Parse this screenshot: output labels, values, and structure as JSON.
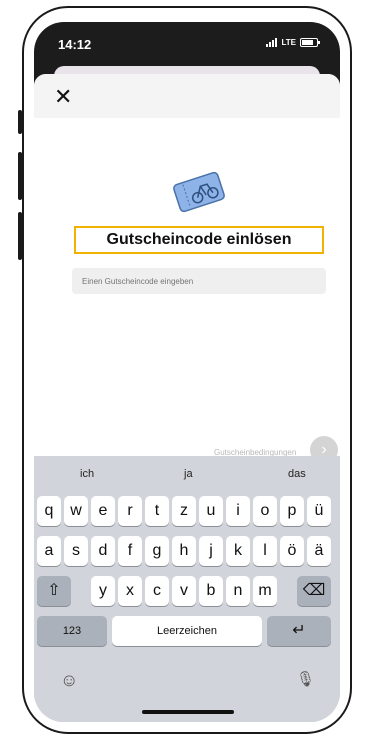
{
  "status_bar": {
    "time": "14:12",
    "network": "LTE"
  },
  "modal": {
    "close_label": "✕",
    "title": "Gutscheincode einlösen",
    "input_placeholder": "Einen Gutscheincode eingeben",
    "terms_text": "Gutscheinbedingungen",
    "next_label": "›"
  },
  "keyboard": {
    "suggestions": [
      "ich",
      "ja",
      "das"
    ],
    "row1": [
      "q",
      "w",
      "e",
      "r",
      "t",
      "z",
      "u",
      "i",
      "o",
      "p",
      "ü"
    ],
    "row2": [
      "a",
      "s",
      "d",
      "f",
      "g",
      "h",
      "j",
      "k",
      "l",
      "ö",
      "ä"
    ],
    "row3": [
      "y",
      "x",
      "c",
      "v",
      "b",
      "n",
      "m"
    ],
    "shift": "⇧",
    "backspace": "⌫",
    "numbers": "123",
    "space": "Leerzeichen",
    "return": "↵",
    "emoji": "☺",
    "mic": "🎙"
  },
  "colors": {
    "accent_border": "#f2b300",
    "ticket_blue": "#5b8fd1"
  }
}
